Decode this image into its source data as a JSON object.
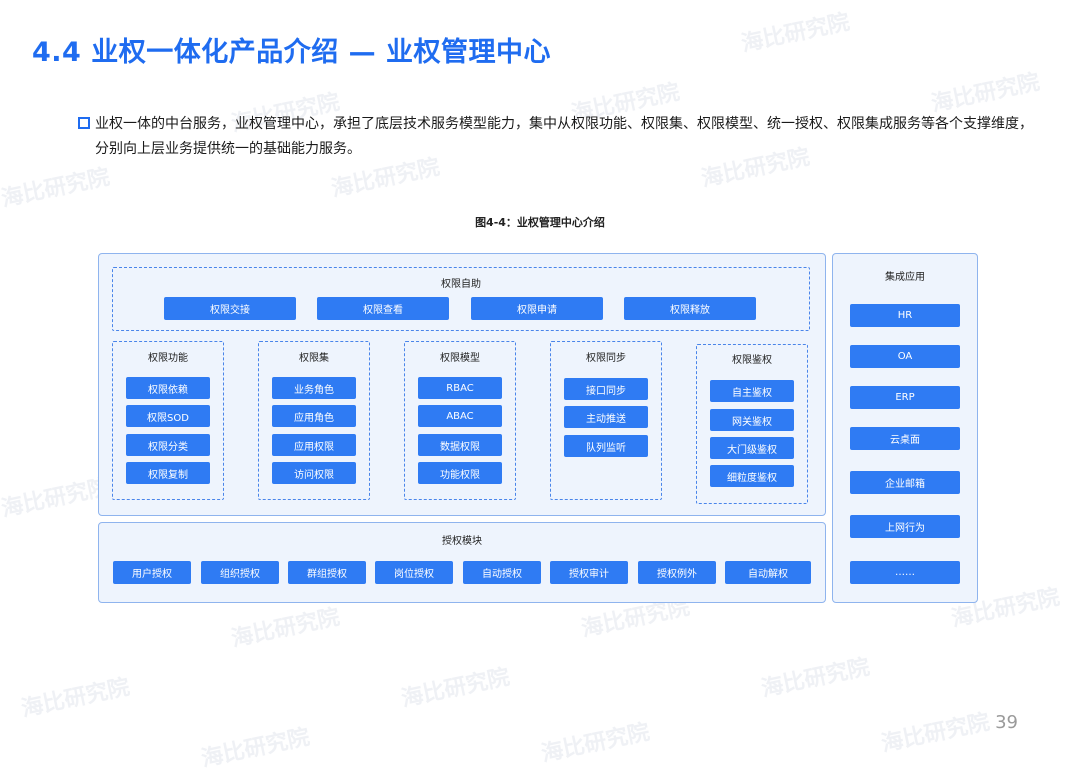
{
  "title": "4.4 业权一体化产品介绍 — 业权管理中心",
  "intro": "业权一体的中台服务，业权管理中心，承担了底层技术服务模型能力，集中从权限功能、权限集、权限模型、统一授权、权限集成服务等各个支撑维度，分别向上层业务提供统一的基础能力服务。",
  "figure_caption": "图4-4：业权管理中心介绍",
  "self_service": {
    "title": "权限自助",
    "items": [
      "权限交接",
      "权限查看",
      "权限申请",
      "权限释放"
    ]
  },
  "columns": [
    {
      "title": "权限功能",
      "items": [
        "权限依赖",
        "权限SOD",
        "权限分类",
        "权限复制"
      ]
    },
    {
      "title": "权限集",
      "items": [
        "业务角色",
        "应用角色",
        "应用权限",
        "访问权限"
      ]
    },
    {
      "title": "权限模型",
      "items": [
        "RBAC",
        "ABAC",
        "数据权限",
        "功能权限"
      ]
    },
    {
      "title": "权限同步",
      "items": [
        "接口同步",
        "主动推送",
        "队列监听"
      ]
    },
    {
      "title": "权限鉴权",
      "items": [
        "自主鉴权",
        "网关鉴权",
        "大门级鉴权",
        "细粒度鉴权"
      ]
    }
  ],
  "auth_module": {
    "title": "授权模块",
    "items": [
      "用户授权",
      "组织授权",
      "群组授权",
      "岗位授权",
      "自动授权",
      "授权审计",
      "授权例外",
      "自动解权"
    ]
  },
  "integration": {
    "title": "集成应用",
    "items": [
      "HR",
      "OA",
      "ERP",
      "云桌面",
      "企业邮箱",
      "上网行为",
      "……"
    ]
  },
  "page_number": "39",
  "watermark_text": "海比研究院"
}
